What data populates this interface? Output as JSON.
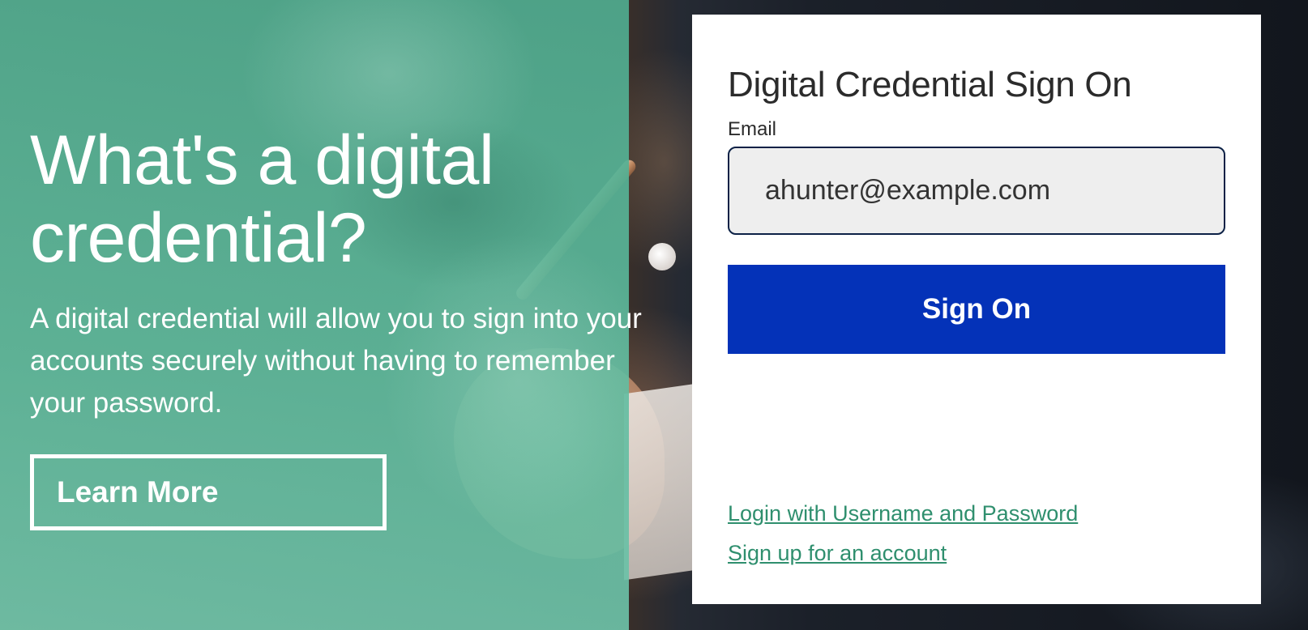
{
  "colors": {
    "overlay_teal": "#58b393",
    "primary_button": "#0432b8",
    "link": "#2f8f6e",
    "input_border": "#0c2146",
    "input_background": "#eeeeee",
    "card_background": "#ffffff"
  },
  "hero": {
    "title": "What's a digital credential?",
    "body": "A digital credential will allow you to sign into your accounts securely without having to remember your password.",
    "learn_more_label": "Learn More"
  },
  "signon_card": {
    "title": "Digital Credential Sign On",
    "email_label": "Email",
    "email_value": "ahunter@example.com",
    "submit_label": "Sign On",
    "links": {
      "login_username": "Login with Username and Password",
      "signup": "Sign up for an account"
    }
  }
}
